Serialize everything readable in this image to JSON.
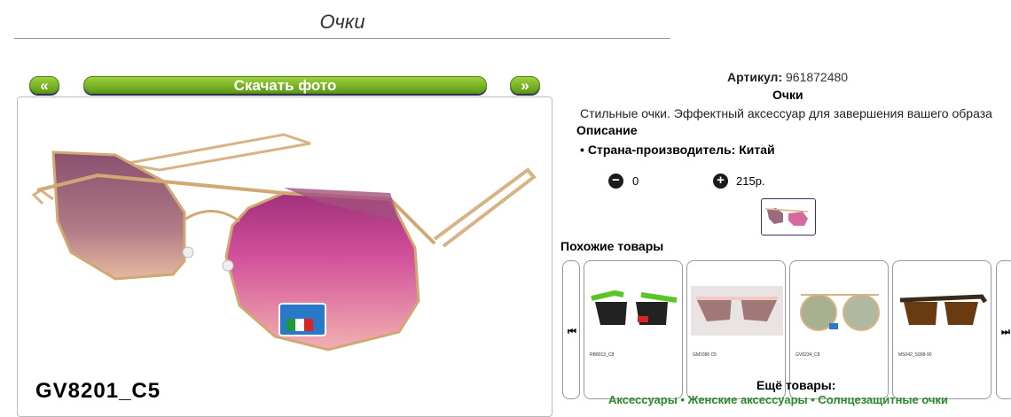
{
  "page": {
    "title": "Очки"
  },
  "nav": {
    "prev": "«",
    "download": "Скачать фото",
    "next": "»"
  },
  "product": {
    "model": "GV8201_C5",
    "article_label": "Артикул:",
    "article": "961872480",
    "name": "Очки",
    "description": "Стильные очки. Эффектный аксессуар для завершения вашего образа",
    "description_heading": "Описание",
    "country": "Страна-производитель: Китай",
    "quantity": "0",
    "price": "215р.",
    "lens_badge": "ITALY Gianni Venezia"
  },
  "similar": {
    "heading": "Похожие товары",
    "prev_icon": "skip-back-icon",
    "next_icon": "skip-forward-icon",
    "items": [
      {
        "code": "RB8013_C8"
      },
      {
        "code": "GM3386 C5"
      },
      {
        "code": "GV8234_C8"
      },
      {
        "code": "MS042_S908-90"
      }
    ]
  },
  "more": {
    "heading": "Ещё товары:",
    "links": "Аксессуары • Женские аксессуары • Солнцезащитные очки"
  },
  "colors": {
    "green_button": "#6aa81f",
    "lens_top": "#8d5a7a",
    "lens_bottom": "#e88aa8",
    "frame": "#d8b98a"
  }
}
